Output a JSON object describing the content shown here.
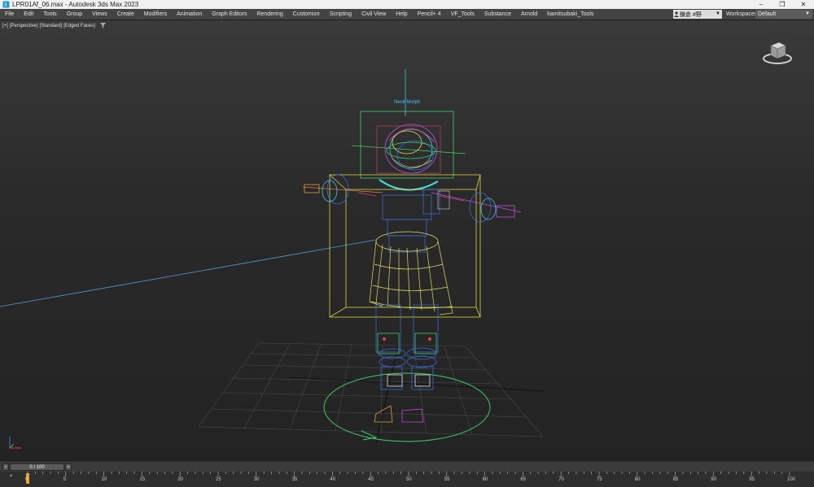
{
  "window": {
    "title": "LPR01Af_06.max - Autodesk 3ds Max 2023",
    "minimize": "–",
    "maximize": "❐",
    "close": "✕"
  },
  "menu": [
    "File",
    "Edit",
    "Tools",
    "Group",
    "Views",
    "Create",
    "Modifiers",
    "Animation",
    "Graph Editors",
    "Rendering",
    "Customize",
    "Scripting",
    "Civil View",
    "Help",
    "Pencil+ 4",
    "VF_Tools",
    "Substance",
    "Arnold",
    "kamitsubaki_Tools"
  ],
  "user": {
    "name": "鎌倉 #野",
    "icon": "user-icon"
  },
  "workspace": {
    "label": "Workspaces:",
    "value": "Default"
  },
  "viewport": {
    "labels": [
      "[+]",
      "[Perspective]",
      "[Standard]",
      "[Edged Faces]"
    ],
    "rig_label": "Neck Morph"
  },
  "timeslider": {
    "value": "0 / 100",
    "prev": "<",
    "next": ">"
  },
  "trackbar": {
    "ticks": [
      "0",
      "5",
      "10",
      "15",
      "20",
      "25",
      "30",
      "35",
      "40",
      "45",
      "50",
      "55",
      "60",
      "65",
      "70",
      "75",
      "80",
      "85",
      "90",
      "95",
      "100"
    ]
  },
  "colors": {
    "accent": "#f0a020",
    "wire_yellow": "#d8d840",
    "wire_blue": "#3a6ad8",
    "wire_green": "#3cd06a",
    "wire_cyan": "#40c8e8"
  }
}
